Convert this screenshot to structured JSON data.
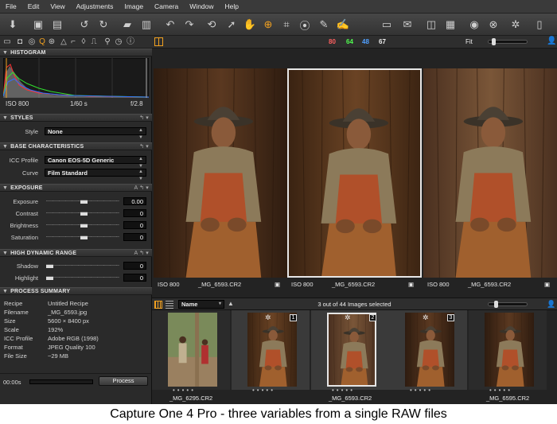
{
  "menu": [
    "File",
    "Edit",
    "View",
    "Adjustments",
    "Image",
    "Camera",
    "Window",
    "Help"
  ],
  "toolbar": {
    "icons": [
      "import-icon",
      "capture-icon",
      "compare-icon",
      "rotate-left-icon",
      "rotate-right-icon",
      "move-to-folder-icon",
      "trash-icon",
      "undo-icon",
      "redo-icon",
      "reset-icon",
      "select-icon",
      "pan-icon",
      "zoom-icon",
      "crop-icon",
      "straighten-icon",
      "white-balance-picker-icon",
      "edit-icon",
      "process-icon",
      "email-icon",
      "export-icon",
      "web-contact-icon",
      "camera-icon",
      "cancel-icon",
      "settings-icon",
      "panels-icon"
    ]
  },
  "main_top": {
    "r": "80",
    "g": "64",
    "b": "48",
    "l": "67",
    "fit": "Fit"
  },
  "histogram": {
    "title": "HISTOGRAM",
    "iso": "ISO 800",
    "shutter": "1/60 s",
    "aperture": "f/2.8"
  },
  "styles": {
    "title": "STYLES",
    "style_label": "Style",
    "style_value": "None"
  },
  "base": {
    "title": "BASE CHARACTERISTICS",
    "icc_label": "ICC Profile",
    "icc_value": "Canon EOS-5D Generic",
    "curve_label": "Curve",
    "curve_value": "Film Standard"
  },
  "exposure": {
    "title": "EXPOSURE",
    "rows": [
      {
        "label": "Exposure",
        "value": "0.00",
        "level": 0.5
      },
      {
        "label": "Contrast",
        "value": "0",
        "level": 0.5
      },
      {
        "label": "Brightness",
        "value": "0",
        "level": 0.5
      },
      {
        "label": "Saturation",
        "value": "0",
        "level": 0.5
      }
    ]
  },
  "hdr": {
    "title": "HIGH DYNAMIC RANGE",
    "rows": [
      {
        "label": "Shadow",
        "value": "0",
        "level": 0
      },
      {
        "label": "Highlight",
        "value": "0",
        "level": 0
      }
    ]
  },
  "summary": {
    "title": "PROCESS SUMMARY",
    "rows": [
      {
        "k": "Recipe",
        "v": "Untitled Recipe"
      },
      {
        "k": "Filename",
        "v": "_MG_6593.jpg"
      },
      {
        "k": "Size",
        "v": "5600 × 8400  px"
      },
      {
        "k": "Scale",
        "v": "192%"
      },
      {
        "k": "ICC Profile",
        "v": "Adobe RGB (1998)"
      },
      {
        "k": "Format",
        "v": "JPEG Quality 100"
      },
      {
        "k": "File Size",
        "v": "~29 MB"
      }
    ],
    "time": "00:00s",
    "process_label": "Process"
  },
  "viewers": [
    {
      "iso": "ISO 800",
      "file": "_MG_6593.CR2"
    },
    {
      "iso": "ISO 800",
      "file": "_MG_6593.CR2"
    },
    {
      "iso": "ISO 800",
      "file": "_MG_6593.CR2"
    }
  ],
  "browser": {
    "sort": "Name",
    "count": "3 out of 44 Images selected"
  },
  "thumbs": [
    {
      "file": "_MG_6295.CR2",
      "badge": ""
    },
    {
      "file": "",
      "badge": "1"
    },
    {
      "file": "_MG_6593.CR2",
      "badge": "2"
    },
    {
      "file": "",
      "badge": "3"
    },
    {
      "file": "_MG_6595.CR2",
      "badge": ""
    }
  ],
  "caption": "Capture One 4 Pro - three variables from a single RAW files",
  "colors": {
    "accent": "#f0a020",
    "r": "#ff6060",
    "g": "#50ff50",
    "b": "#50a0ff"
  }
}
